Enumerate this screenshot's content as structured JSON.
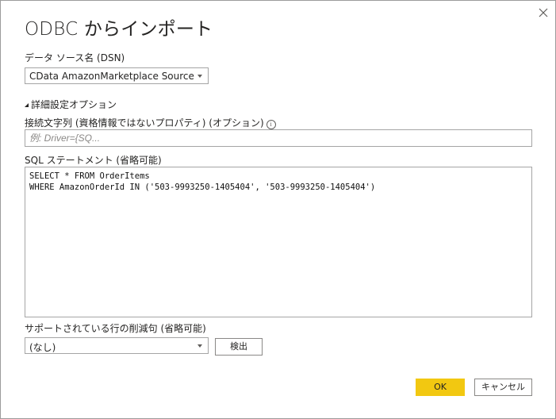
{
  "dialog": {
    "title": "ODBC からインポート",
    "close_icon": "close-icon"
  },
  "dsn": {
    "label": "データ ソース名 (DSN)",
    "selected": "CData AmazonMarketplace Source"
  },
  "advanced": {
    "label": "詳細設定オプション",
    "connection_string": {
      "label": "接続文字列 (資格情報ではないプロパティ) (オプション)",
      "info_icon": "i",
      "placeholder": "例: Driver={SQ...",
      "value": ""
    },
    "sql": {
      "label": "SQL ステートメント (省略可能)",
      "value": "SELECT * FROM OrderItems\nWHERE AmazonOrderId IN ('503-9993250-1405404', '503-9993250-1405404')"
    },
    "row_reduction": {
      "label": "サポートされている行の削減句 (省略可能)",
      "selected": "(なし)",
      "detect_button": "検出"
    }
  },
  "footer": {
    "ok_label": "OK",
    "cancel_label": "キャンセル"
  },
  "colors": {
    "accent": "#F2C811",
    "border": "#A5A5A5",
    "text": "#252423"
  }
}
